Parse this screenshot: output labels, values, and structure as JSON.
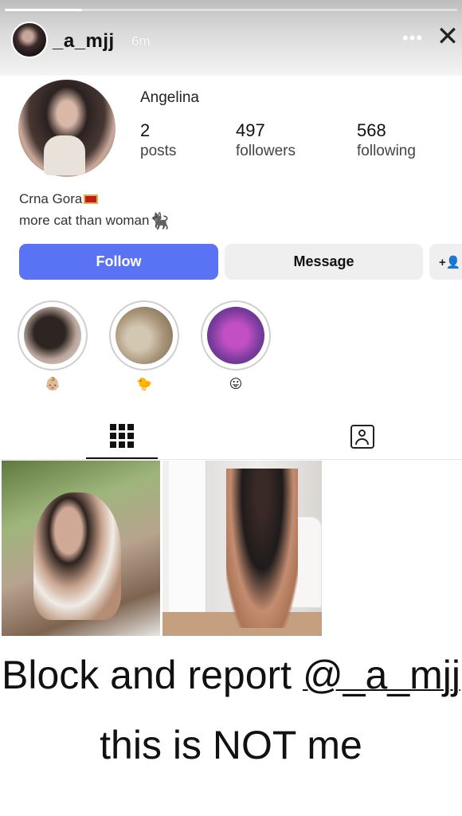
{
  "story": {
    "username": "_a_mjj",
    "time_ago": "6m",
    "more_icon": "more-icon",
    "close_icon": "close-icon",
    "progress": 0.17
  },
  "profile": {
    "name": "Angelina",
    "stats": [
      {
        "value": "2",
        "label": "posts"
      },
      {
        "value": "497",
        "label": "followers"
      },
      {
        "value": "568",
        "label": "following"
      }
    ],
    "bio": {
      "line1": "Crna Gora",
      "line1_emoji": "flag-montenegro-icon",
      "line2": "more cat than woman",
      "line2_emoji": "cat-icon"
    }
  },
  "actions": {
    "follow_label": "Follow",
    "message_label": "Message",
    "add_user_label": "+ꔮ"
  },
  "highlights": [
    {
      "emoji": "👶🏼"
    },
    {
      "emoji": "🐤"
    },
    {
      "emoji": "😛"
    }
  ],
  "tabs": [
    {
      "icon": "grid-icon",
      "selected": true
    },
    {
      "icon": "tagged-icon",
      "selected": false
    }
  ],
  "caption": {
    "line1_prefix": "Block and report ",
    "line1_mention": "@_a_mjj",
    "line2": "this is NOT me"
  },
  "colors": {
    "follow_button": "#5a73f4",
    "secondary_button": "#efefef"
  }
}
